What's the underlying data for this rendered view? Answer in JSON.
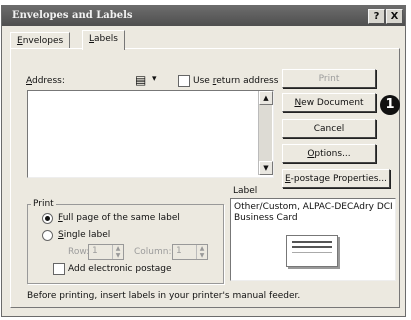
{
  "dialog": {
    "title": "Envelopes and Labels"
  },
  "titlebar": {
    "help_glyph": "?",
    "close_glyph": "X"
  },
  "tabs": [
    {
      "label": "Envelopes",
      "key": "E",
      "rest": "nvelopes"
    },
    {
      "label": "Labels",
      "key": "L",
      "rest": "abels"
    }
  ],
  "address": {
    "label_key": "A",
    "label_rest": "ddress:",
    "value": "",
    "book_glyph": "▤",
    "dropdown_glyph": "▾",
    "use_return_prefix": "Use ",
    "use_return_key": "r",
    "use_return_rest": "eturn address",
    "use_return_checked": false
  },
  "buttons": {
    "print": "Print",
    "new_document_key": "N",
    "new_document_rest": "ew Document",
    "cancel": "Cancel",
    "options_key": "O",
    "options_rest": "ptions...",
    "epostage_key": "E",
    "epostage_rest": "-postage Properties..."
  },
  "callout": {
    "number": "1"
  },
  "print_group": {
    "title": "Print",
    "full_page_key": "F",
    "full_page_rest": "ull page of the same label",
    "single_key": "S",
    "single_rest": "ingle label",
    "selected": "full_page",
    "row_label": "Row:",
    "row_value": "1",
    "column_label": "Column:",
    "column_value": "1",
    "add_postage": "Add electronic postage",
    "add_postage_checked": false
  },
  "label_group": {
    "title": "Label",
    "line1": "Other/Custom, ALPAC-DECAdry DCI",
    "line2": "Business Card"
  },
  "footer": {
    "hint": "Before printing, insert labels in your printer's manual feeder."
  }
}
